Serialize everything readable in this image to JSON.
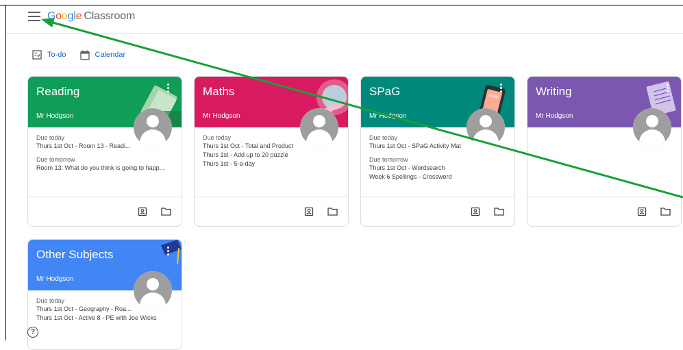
{
  "header": {
    "logo_letters": [
      "G",
      "o",
      "o",
      "g",
      "l",
      "e"
    ],
    "logo_suffix": "Classroom"
  },
  "toolbar": {
    "todo_label": "To-do",
    "calendar_label": "Calendar"
  },
  "cards": [
    {
      "title": "Reading",
      "teacher": "Mr Hodgson",
      "color": "#0f9d58",
      "groups": [
        {
          "label": "Due today",
          "items": [
            "Thurs 1st Oct - Room 13 - Readi..."
          ]
        },
        {
          "label": "Due tomorrow",
          "items": [
            "Room 13: What do you think is going to happ..."
          ]
        }
      ]
    },
    {
      "title": "Maths",
      "teacher": "Mr Hodgson",
      "color": "#d81b60",
      "groups": [
        {
          "label": "Due today",
          "items": [
            "Thurs 1st Oct - Total and Product",
            "Thurs 1st - Add up to 20 puzzle",
            "Thurs 1st - 5-a-day"
          ]
        }
      ]
    },
    {
      "title": "SPaG",
      "teacher": "Mr Hodgson",
      "color": "#00897b",
      "groups": [
        {
          "label": "Due today",
          "items": [
            "Thurs 1st Oct - SPaG Activity Mat"
          ]
        },
        {
          "label": "Due tomorrow",
          "items": [
            "Thurs 1st Oct - Wordsearch",
            "Week 6 Spellings - Crossword"
          ]
        }
      ]
    },
    {
      "title": "Writing",
      "teacher": "Mr Hodgson",
      "color": "#7b57b0",
      "groups": []
    },
    {
      "title": "Other Subjects",
      "teacher": "Mr Hodgson",
      "color": "#4285f4",
      "groups": [
        {
          "label": "Due today",
          "items": [
            "Thurs 1st Oct - Geography - Roa...",
            "Thurs 1st Oct - Active 8 - PE with Joe Wicks"
          ]
        }
      ]
    }
  ],
  "help": {
    "symbol": "?"
  },
  "annotation_color": "#1a9e3a"
}
